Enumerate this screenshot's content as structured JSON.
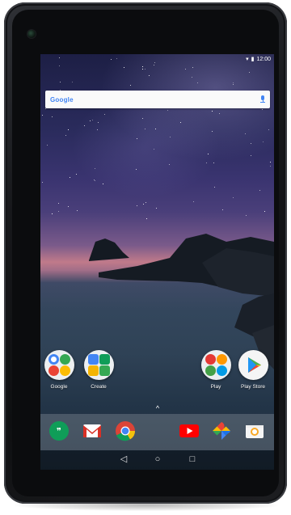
{
  "status": {
    "wifi_icon": "wifi-icon",
    "battery_icon": "battery-icon",
    "time": "12:00"
  },
  "search": {
    "logo_text": "Google",
    "mic_icon": "microphone-icon"
  },
  "apps": [
    {
      "label": "Google",
      "icon": "google-folder-icon"
    },
    {
      "label": "Create",
      "icon": "create-folder-icon"
    },
    {
      "label": "Play",
      "icon": "play-folder-icon"
    },
    {
      "label": "Play Store",
      "icon": "play-store-icon"
    }
  ],
  "dock": [
    {
      "icon": "hangouts-icon",
      "color": "#0f9d58"
    },
    {
      "icon": "gmail-icon",
      "color": "#d93025"
    },
    {
      "icon": "chrome-icon",
      "color": "#4285f4"
    },
    {
      "icon": "youtube-icon",
      "color": "#ff0000"
    },
    {
      "icon": "photos-icon",
      "color": "#fbbc04"
    },
    {
      "icon": "camera-icon",
      "color": "#f9a825"
    }
  ],
  "nav": {
    "back_glyph": "◁",
    "home_glyph": "○",
    "recents_glyph": "□"
  },
  "drawer_glyph": "^"
}
